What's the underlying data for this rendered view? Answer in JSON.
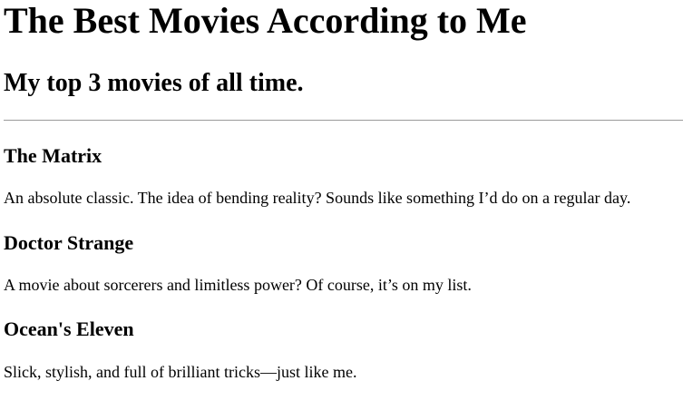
{
  "page": {
    "title": "The Best Movies According to Me",
    "subtitle": "My top 3 movies of all time."
  },
  "movies": [
    {
      "title": "The Matrix",
      "description": "An absolute classic. The idea of bending reality? Sounds like something I’d do on a regular day."
    },
    {
      "title": "Doctor Strange",
      "description": "A movie about sorcerers and limitless power? Of course, it’s on my list."
    },
    {
      "title": "Ocean's Eleven",
      "description": "Slick, stylish, and full of brilliant tricks—just like me."
    }
  ]
}
